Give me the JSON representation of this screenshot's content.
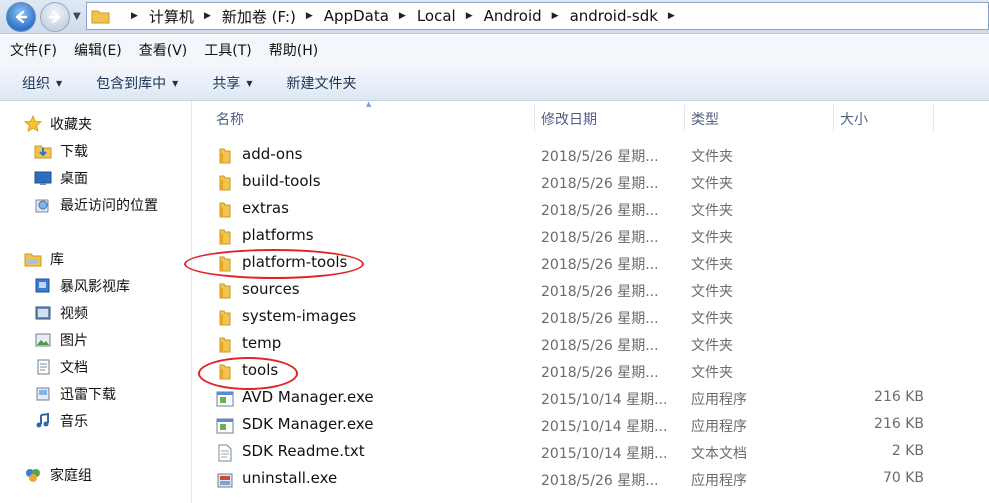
{
  "address": {
    "crumbs": [
      "计算机",
      "新加卷 (F:)",
      "AppData",
      "Local",
      "Android",
      "android-sdk"
    ]
  },
  "menu": [
    "文件(F)",
    "编辑(E)",
    "查看(V)",
    "工具(T)",
    "帮助(H)"
  ],
  "toolbar": {
    "organize": "组织",
    "include_library": "包含到库中",
    "share": "共享",
    "new_folder": "新建文件夹"
  },
  "nav": {
    "favorites": {
      "label": "收藏夹",
      "items": [
        "下载",
        "桌面",
        "最近访问的位置"
      ]
    },
    "libraries": {
      "label": "库",
      "items": [
        "暴风影视库",
        "视频",
        "图片",
        "文档",
        "迅雷下载",
        "音乐"
      ]
    },
    "homegroup": "家庭组"
  },
  "columns": {
    "name": "名称",
    "date": "修改日期",
    "type": "类型",
    "size": "大小"
  },
  "files": [
    {
      "name": "add-ons",
      "date": "2018/5/26 星期...",
      "type": "文件夹",
      "size": "",
      "icon": "folder-icon"
    },
    {
      "name": "build-tools",
      "date": "2018/5/26 星期...",
      "type": "文件夹",
      "size": "",
      "icon": "folder-icon"
    },
    {
      "name": "extras",
      "date": "2018/5/26 星期...",
      "type": "文件夹",
      "size": "",
      "icon": "folder-icon"
    },
    {
      "name": "platforms",
      "date": "2018/5/26 星期...",
      "type": "文件夹",
      "size": "",
      "icon": "folder-icon"
    },
    {
      "name": "platform-tools",
      "date": "2018/5/26 星期...",
      "type": "文件夹",
      "size": "",
      "icon": "folder-icon",
      "highlighted": true
    },
    {
      "name": "sources",
      "date": "2018/5/26 星期...",
      "type": "文件夹",
      "size": "",
      "icon": "folder-icon"
    },
    {
      "name": "system-images",
      "date": "2018/5/26 星期...",
      "type": "文件夹",
      "size": "",
      "icon": "folder-icon"
    },
    {
      "name": "temp",
      "date": "2018/5/26 星期...",
      "type": "文件夹",
      "size": "",
      "icon": "folder-icon"
    },
    {
      "name": "tools",
      "date": "2018/5/26 星期...",
      "type": "文件夹",
      "size": "",
      "icon": "folder-icon",
      "highlighted": true
    },
    {
      "name": "AVD Manager.exe",
      "date": "2015/10/14 星期...",
      "type": "应用程序",
      "size": "216 KB",
      "icon": "app-icon"
    },
    {
      "name": "SDK Manager.exe",
      "date": "2015/10/14 星期...",
      "type": "应用程序",
      "size": "216 KB",
      "icon": "app-icon"
    },
    {
      "name": "SDK Readme.txt",
      "date": "2015/10/14 星期...",
      "type": "文本文档",
      "size": "2 KB",
      "icon": "text-file-icon"
    },
    {
      "name": "uninstall.exe",
      "date": "2018/5/26 星期...",
      "type": "应用程序",
      "size": "70 KB",
      "icon": "installer-icon"
    }
  ],
  "colors": {
    "highlight_circle": "#e0232b",
    "folder": "#f2c44d"
  }
}
